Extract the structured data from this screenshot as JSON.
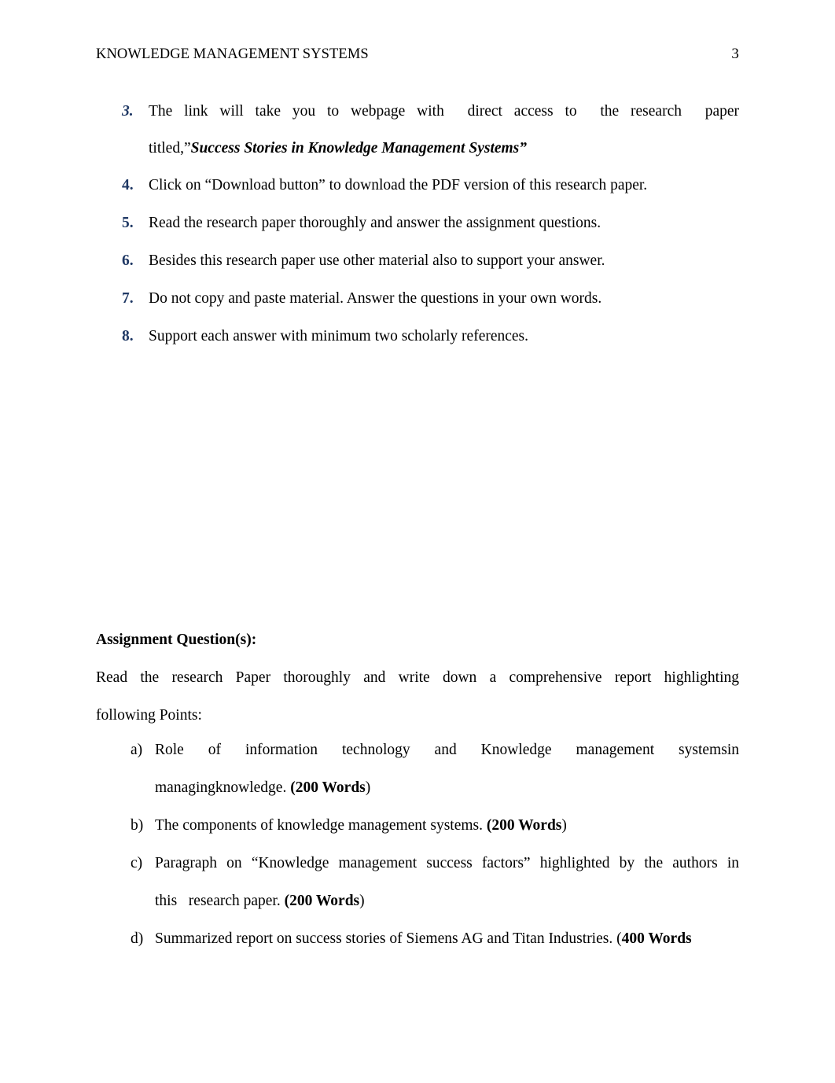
{
  "document": {
    "header": {
      "title": "KNOWLEDGE MANAGEMENT SYSTEMS",
      "page_number": "3"
    },
    "accent_color": "#1F3864",
    "text_color": "#000000",
    "background_color": "#FFFFFF"
  },
  "instructions": {
    "items": [
      {
        "marker": "3.",
        "line1": "The  link  will  take  you  to  webpage  with    direct  access  to    the  research    paper",
        "line2_prefix": "titled,”",
        "line2_title": "Success Stories in Knowledge Management Systems”"
      },
      {
        "marker": "4.",
        "line1": "Click on “Download button” to download the PDF version of this research paper."
      },
      {
        "marker": "5.",
        "line1": "Read the research paper thoroughly and answer the assignment questions."
      },
      {
        "marker": "6.",
        "line1": "Besides this research paper use other material also to support your answer."
      },
      {
        "marker": "7.",
        "line1": "Do not copy and paste material. Answer the questions in your own words."
      },
      {
        "marker": "8.",
        "line1": "Support each answer with minimum two scholarly references."
      }
    ]
  },
  "assignment": {
    "heading": "Assignment Question(s):",
    "intro_line1": "Read the research Paper thoroughly and write down a comprehensive report highlighting",
    "intro_line2": "following Points:",
    "points": [
      {
        "marker": "a)",
        "line1": "Role  of  information  technology  and  Knowledge  management  systemsin",
        "line2_text": "managingknowledge. ",
        "line2_bold": "(200 Words",
        "line2_tail": ")"
      },
      {
        "marker": "b)",
        "line1_text": "The components of knowledge management systems. ",
        "line1_bold": "(200 Words",
        "line1_tail": ")"
      },
      {
        "marker": "c)",
        "line1": "Paragraph on “Knowledge management success factors” highlighted by the authors in",
        "line2_text": "this   research paper. ",
        "line2_bold": "(200 Words",
        "line2_tail": ")"
      },
      {
        "marker": "d)",
        "line1_text": "Summarized report on success stories of Siemens AG and Titan Industries. (",
        "line1_bold": "400 Words",
        "line1_tail": ""
      }
    ]
  }
}
